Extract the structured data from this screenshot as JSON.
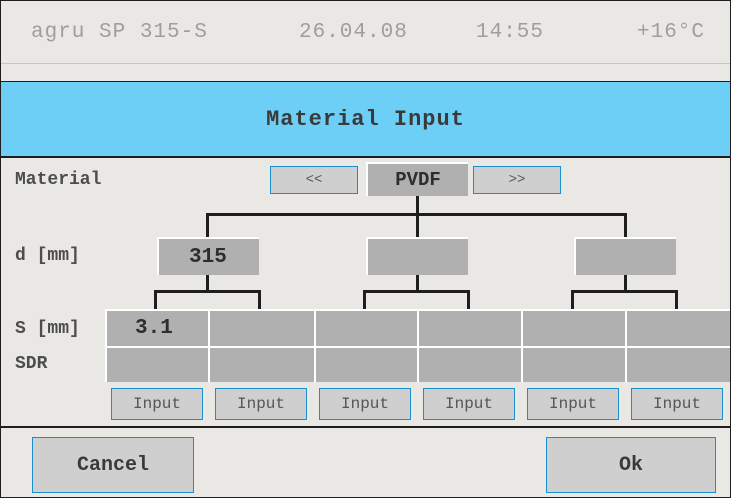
{
  "status": {
    "device": "agru SP 315-S",
    "date": "26.04.08",
    "time": "14:55",
    "temperature": "+16°C"
  },
  "title": "Material Input",
  "material": {
    "label": "Material",
    "prev_label": "<<",
    "value": "PVDF",
    "next_label": ">>"
  },
  "diameter": {
    "label": "d [mm]",
    "values": [
      "315",
      "",
      ""
    ]
  },
  "wall": {
    "label": "S [mm]",
    "values": [
      "3.1",
      "",
      "",
      "",
      "",
      ""
    ]
  },
  "sdr": {
    "label": "SDR",
    "values": [
      "",
      "",
      "",
      "",
      "",
      ""
    ]
  },
  "input_buttons": [
    "Input",
    "Input",
    "Input",
    "Input",
    "Input",
    "Input"
  ],
  "footer": {
    "cancel_label": "Cancel",
    "ok_label": "Ok"
  },
  "colors": {
    "title_bar": "#6dcef6",
    "panel": "#eae8e5",
    "value_box": "#b0b0b0",
    "button_border": "#1a8fd0"
  }
}
